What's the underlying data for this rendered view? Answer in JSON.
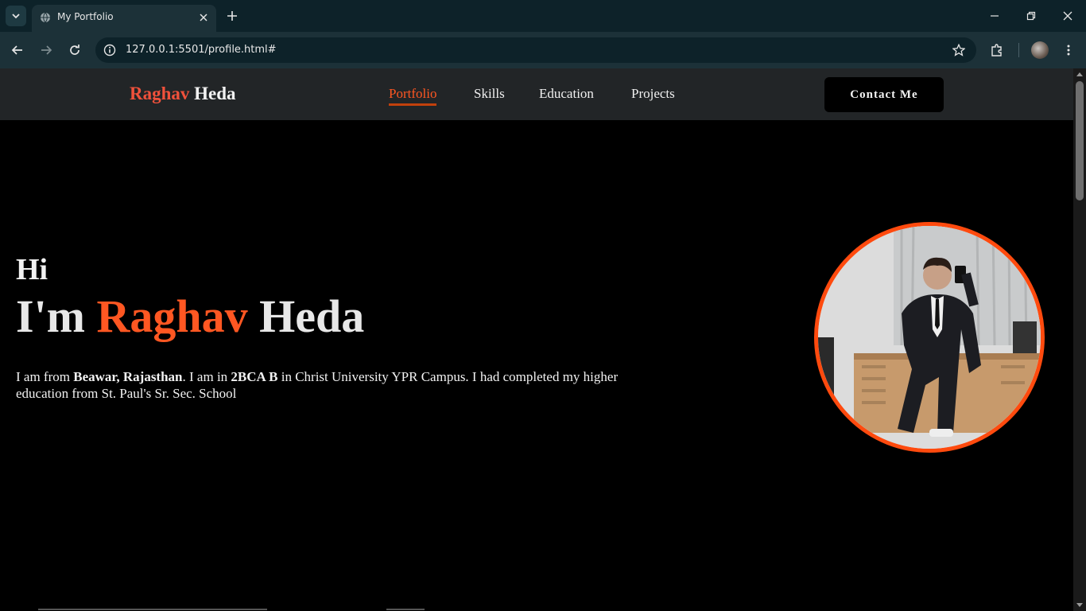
{
  "browser": {
    "tab_title": "My Portfolio",
    "url": "127.0.0.1:5501/profile.html#"
  },
  "site": {
    "logo_first": "Raghav",
    "logo_last": "Heda",
    "nav": [
      {
        "label": "Portfolio",
        "active": true
      },
      {
        "label": "Skills",
        "active": false
      },
      {
        "label": "Education",
        "active": false
      },
      {
        "label": "Projects",
        "active": false
      }
    ],
    "contact_label": "Contact Me"
  },
  "hero": {
    "greeting": "Hi",
    "im": "I'm",
    "name_first": "Raghav",
    "name_last": "Heda",
    "bio": {
      "t1": "I am from ",
      "b1": "Beawar, Rajasthan",
      "t2": ". I am in ",
      "b2": "2BCA B",
      "t3": " in Christ University YPR Campus. I had completed my higher education from St. Paul's Sr. Sec. School"
    }
  },
  "colors": {
    "accent": "#ff5722",
    "logo_accent": "#f0513b",
    "photo_border": "#ff4a0e",
    "nav_bg": "#222527",
    "page_bg": "#000000",
    "chrome_bg": "#1c3138"
  },
  "icons": {
    "tab_search": "chevron-down-icon",
    "favicon": "globe-icon",
    "tab_close": "close-icon",
    "new_tab": "plus-icon",
    "back": "arrow-left-icon",
    "forward": "arrow-right-icon",
    "reload": "reload-icon",
    "site_info": "info-icon",
    "bookmark": "star-icon",
    "extensions": "puzzle-icon",
    "menu": "more-vertical-icon",
    "minimize": "minimize-icon",
    "restore": "restore-icon",
    "close_window": "close-icon"
  }
}
